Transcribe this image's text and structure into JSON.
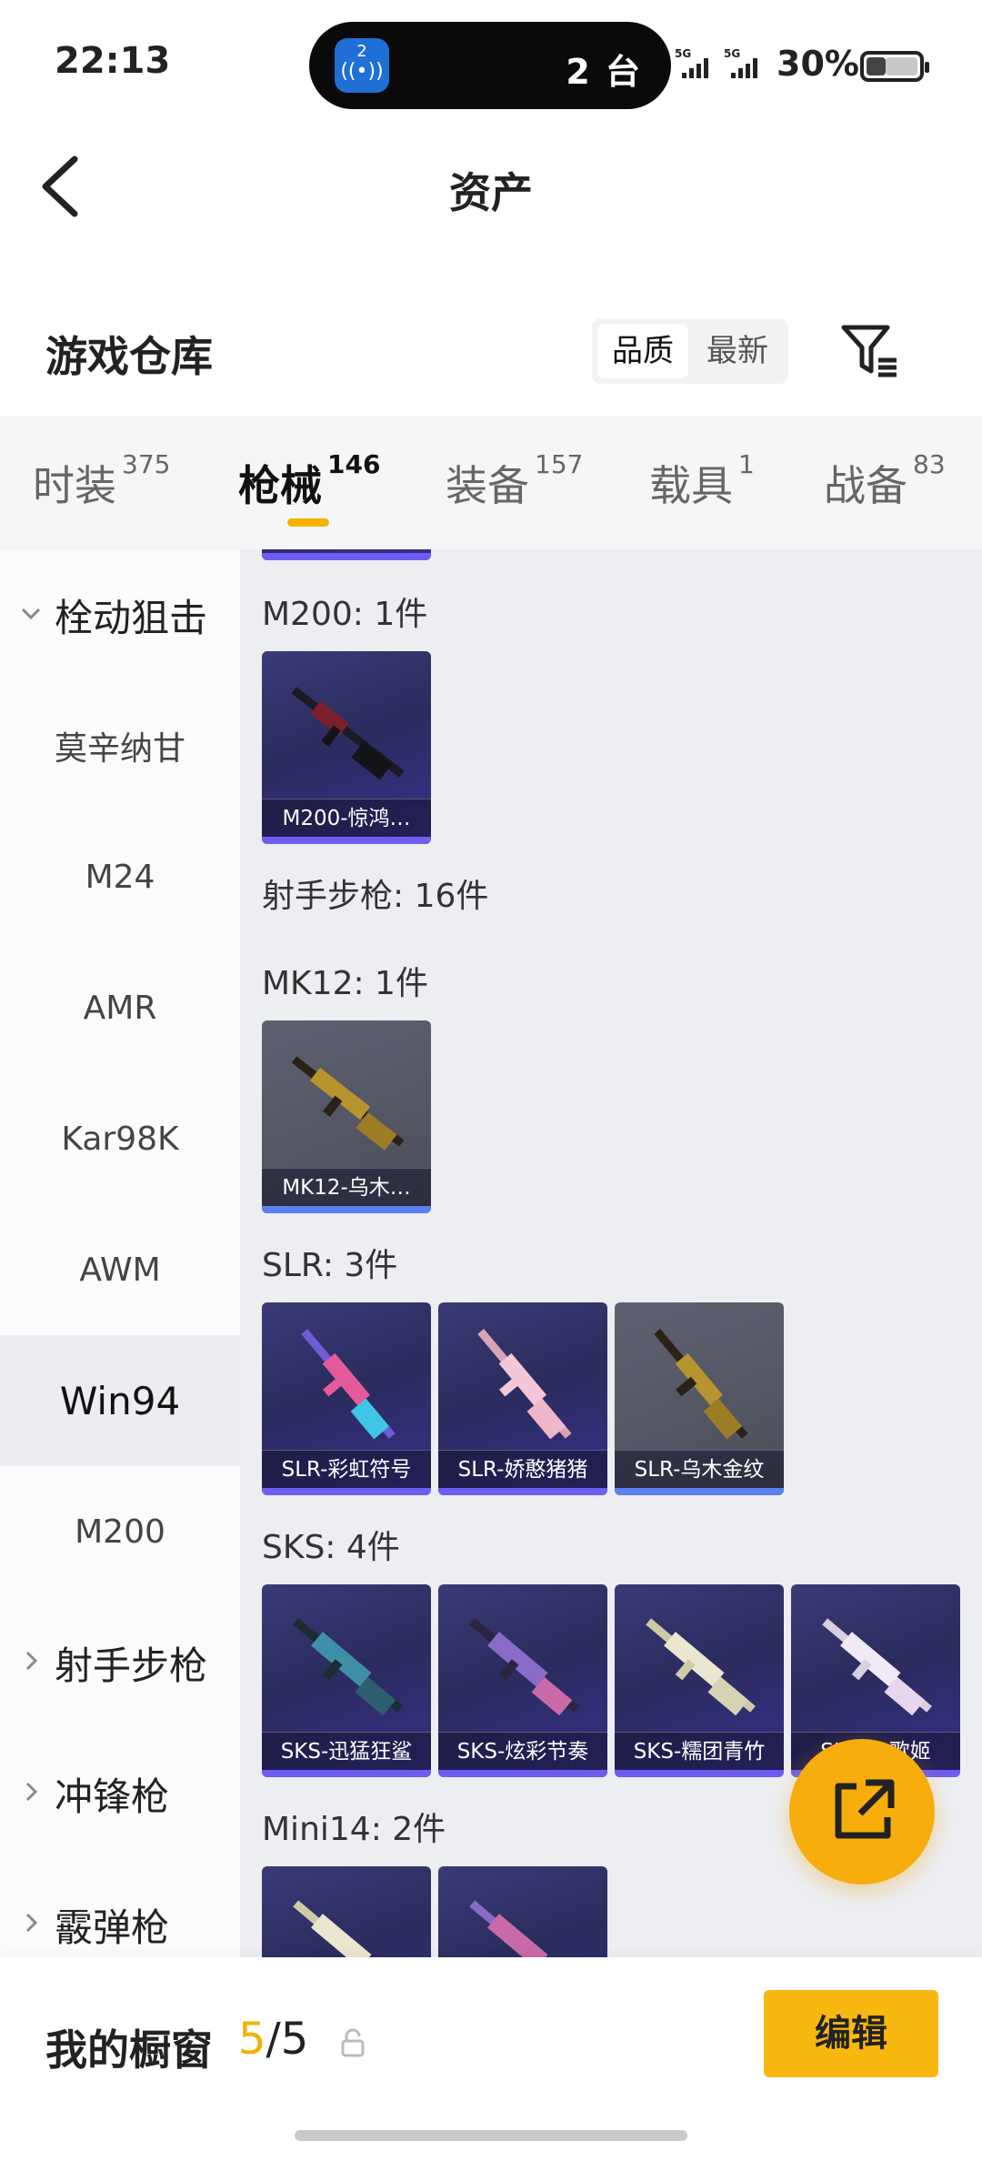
{
  "status_bar": {
    "time": "22:13",
    "island_app_badge": "2",
    "island_app_icon": "broadcast-icon",
    "island_text": "2 台",
    "sim1_label": "5G",
    "sim2_label": "5G",
    "battery_pct": "30%"
  },
  "header": {
    "title": "资产",
    "back_icon": "chevron-left-icon"
  },
  "warehouse": {
    "title": "游戏仓库",
    "sort_options": [
      "品质",
      "最新"
    ],
    "sort_selected": "品质",
    "filter_icon": "filter-icon"
  },
  "tabs": [
    {
      "label": "时装",
      "count": "375"
    },
    {
      "label": "枪械",
      "count": "146"
    },
    {
      "label": "装备",
      "count": "157"
    },
    {
      "label": "载具",
      "count": "1"
    },
    {
      "label": "战备",
      "count": "83"
    }
  ],
  "active_tab": "枪械",
  "sidebar": {
    "items": [
      {
        "label": "栓动狙击",
        "type": "group",
        "expanded": true
      },
      {
        "label": "莫辛纳甘",
        "type": "item"
      },
      {
        "label": "M24",
        "type": "item"
      },
      {
        "label": "AMR",
        "type": "item"
      },
      {
        "label": "Kar98K",
        "type": "item"
      },
      {
        "label": "AWM",
        "type": "item"
      },
      {
        "label": "Win94",
        "type": "item",
        "selected": true
      },
      {
        "label": "M200",
        "type": "item"
      },
      {
        "label": "射手步枪",
        "type": "group",
        "expanded": false
      },
      {
        "label": "冲锋枪",
        "type": "group",
        "expanded": false
      },
      {
        "label": "霰弹枪",
        "type": "group",
        "expanded": false
      }
    ]
  },
  "content": {
    "sections": [
      {
        "heading": "M200: 1件",
        "cards": [
          {
            "label": "M200-惊鸿…",
            "bg": "purple"
          }
        ]
      },
      {
        "heading": "射手步枪: 16件",
        "cards": []
      },
      {
        "heading": "MK12: 1件",
        "cards": [
          {
            "label": "MK12-乌木…",
            "bg": "gray"
          }
        ]
      },
      {
        "heading": "SLR: 3件",
        "cards": [
          {
            "label": "SLR-彩虹符号",
            "bg": "purple"
          },
          {
            "label": "SLR-娇憨猪猪",
            "bg": "purple"
          },
          {
            "label": "SLR-乌木金纹",
            "bg": "gray"
          }
        ]
      },
      {
        "heading": "SKS: 4件",
        "cards": [
          {
            "label": "SKS-迅猛狂鲨",
            "bg": "purple"
          },
          {
            "label": "SKS-炫彩节奏",
            "bg": "purple"
          },
          {
            "label": "SKS-糯团青竹",
            "bg": "purple"
          },
          {
            "label": "SKS-…歌姬",
            "bg": "purple"
          }
        ]
      },
      {
        "heading": "Mini14: 2件",
        "cards": [
          {
            "label": "",
            "bg": "purple"
          },
          {
            "label": "",
            "bg": "purple"
          }
        ]
      }
    ]
  },
  "fab_icon": "share-external-icon",
  "bottom": {
    "label": "我的橱窗",
    "current": "5",
    "separator": "/",
    "total": "5",
    "lock_icon": "lock-icon",
    "edit_label": "编辑"
  },
  "colors": {
    "accent": "#F7AD0C",
    "card_purple": "#2F2F66",
    "card_gray": "#55575F",
    "card_bar": "#6D5DF2"
  }
}
